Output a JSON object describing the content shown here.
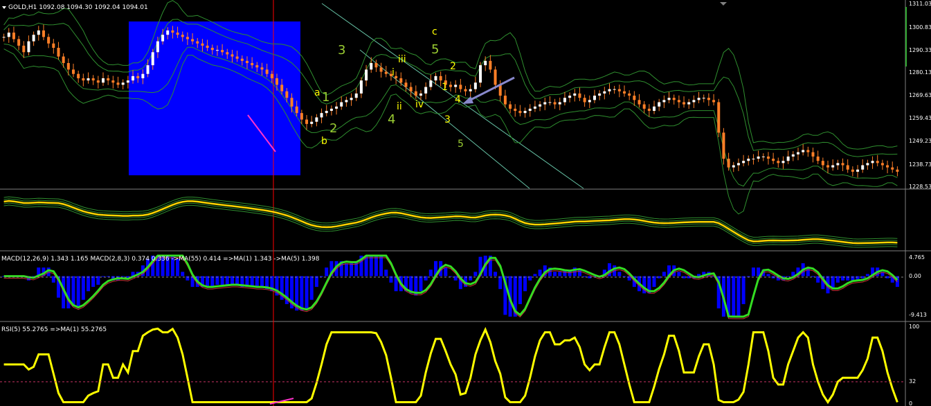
{
  "chart_data": [
    {
      "type": "candlestick",
      "symbol_header": "GOLD,H1  1092.08 1094.30 1092.04 1094.01",
      "y_ticks": [
        "1311.03",
        "1300.83",
        "1290.33",
        "1280.13",
        "1269.63",
        "1259.43",
        "1249.23",
        "1238.73",
        "1228.53"
      ],
      "ylim": [
        1226,
        1313
      ],
      "close_series": [
        1296,
        1298,
        1295,
        1292,
        1289,
        1294,
        1297,
        1299,
        1296,
        1293,
        1291,
        1287,
        1284,
        1281,
        1279,
        1277,
        1276,
        1277,
        1276,
        1275,
        1277,
        1276,
        1275,
        1274,
        1275,
        1276,
        1278,
        1277,
        1279,
        1283,
        1289,
        1294,
        1297,
        1299,
        1298,
        1297,
        1296,
        1295,
        1294,
        1293,
        1292,
        1291,
        1290,
        1290,
        1289,
        1288,
        1287,
        1286,
        1285,
        1284,
        1283,
        1282,
        1281,
        1279,
        1277,
        1274,
        1271,
        1268,
        1264,
        1261,
        1258,
        1256,
        1257,
        1259,
        1261,
        1262,
        1263,
        1264,
        1266,
        1267,
        1268,
        1270,
        1276,
        1281,
        1284,
        1282,
        1280,
        1279,
        1278,
        1277,
        1275,
        1273,
        1271,
        1269,
        1270,
        1273,
        1276,
        1278,
        1276,
        1274,
        1273,
        1274,
        1272,
        1271,
        1272,
        1275,
        1283,
        1285,
        1281,
        1274,
        1269,
        1265,
        1263,
        1262,
        1261,
        1262,
        1263,
        1264,
        1265,
        1266,
        1266,
        1265,
        1266,
        1268,
        1269,
        1270,
        1268,
        1266,
        1267,
        1269,
        1270,
        1271,
        1272,
        1272,
        1271,
        1270,
        1269,
        1267,
        1265,
        1263,
        1262,
        1264,
        1266,
        1267,
        1268,
        1267,
        1266,
        1265,
        1266,
        1267,
        1268,
        1268,
        1267,
        1266,
        1252,
        1240,
        1236,
        1237,
        1238,
        1239,
        1240,
        1240,
        1241,
        1241,
        1240,
        1239,
        1238,
        1239,
        1241,
        1242,
        1243,
        1244,
        1243,
        1241,
        1239,
        1237,
        1236,
        1237,
        1238,
        1237,
        1235,
        1234,
        1235,
        1237,
        1238,
        1239,
        1238,
        1237,
        1236,
        1235,
        1234
      ],
      "wave_labels": [
        {
          "text": "a",
          "color": "yellow",
          "size": "s",
          "x": 454,
          "y": 138
        },
        {
          "text": "1",
          "color": "green",
          "size": "l",
          "x": 465,
          "y": 146
        },
        {
          "text": "2",
          "color": "green",
          "size": "l",
          "x": 476,
          "y": 191
        },
        {
          "text": "b",
          "color": "yellow",
          "size": "s",
          "x": 464,
          "y": 208
        },
        {
          "text": "3",
          "color": "green",
          "size": "l",
          "x": 488,
          "y": 78
        },
        {
          "text": "i",
          "color": "yellow",
          "size": "s",
          "x": 566,
          "y": 109
        },
        {
          "text": "iii",
          "color": "yellow",
          "size": "s",
          "x": 575,
          "y": 90
        },
        {
          "text": "ii",
          "color": "yellow",
          "size": "s",
          "x": 573,
          "y": 158
        },
        {
          "text": "4",
          "color": "green",
          "size": "l",
          "x": 560,
          "y": 178
        },
        {
          "text": "iv",
          "color": "yellow",
          "size": "s",
          "x": 600,
          "y": 155
        },
        {
          "text": "c",
          "color": "yellow",
          "size": "s",
          "x": 624,
          "y": 50
        },
        {
          "text": "5",
          "color": "green",
          "size": "l",
          "x": 623,
          "y": 77
        },
        {
          "text": "2",
          "color": "yellow",
          "size": "s",
          "x": 650,
          "y": 100
        },
        {
          "text": "1",
          "color": "yellow",
          "size": "s",
          "x": 638,
          "y": 130
        },
        {
          "text": "4",
          "color": "yellow",
          "size": "s",
          "x": 657,
          "y": 148
        },
        {
          "text": "3",
          "color": "yellow",
          "size": "s",
          "x": 642,
          "y": 177
        },
        {
          "text": "5",
          "color": "green",
          "size": "s",
          "x": 661,
          "y": 212
        }
      ]
    },
    {
      "type": "line",
      "name": "overlay indicator"
    },
    {
      "type": "line",
      "header": "MACD(12,26,9) 1.343 1.165  MACD(2,8,3) 0.374 0.336  ->MA(55) 0.414  =>MA(1) 1.343  ->MA(5) 1.398",
      "y_ticks": [
        "4.765",
        "0.00",
        "-9.413"
      ],
      "ylim": [
        -9.413,
        4.765
      ]
    },
    {
      "type": "line",
      "header": "RSI(5) 55.2765  =>MA(1) 55.2765",
      "y_ticks": [
        "100",
        "32",
        "0"
      ],
      "ylim": [
        0,
        100
      ],
      "level": 32
    }
  ],
  "colors": {
    "background": "#000000",
    "bull_candle": "#ff7f27",
    "bear_candle": "#ff7f27",
    "band": "#2f8f2f",
    "highlight_box": "#0000ff",
    "rsi": "#ffff00",
    "macd_hist": "#0000ff",
    "macd_line": "#33dd22",
    "cursor": "#ff0000"
  }
}
